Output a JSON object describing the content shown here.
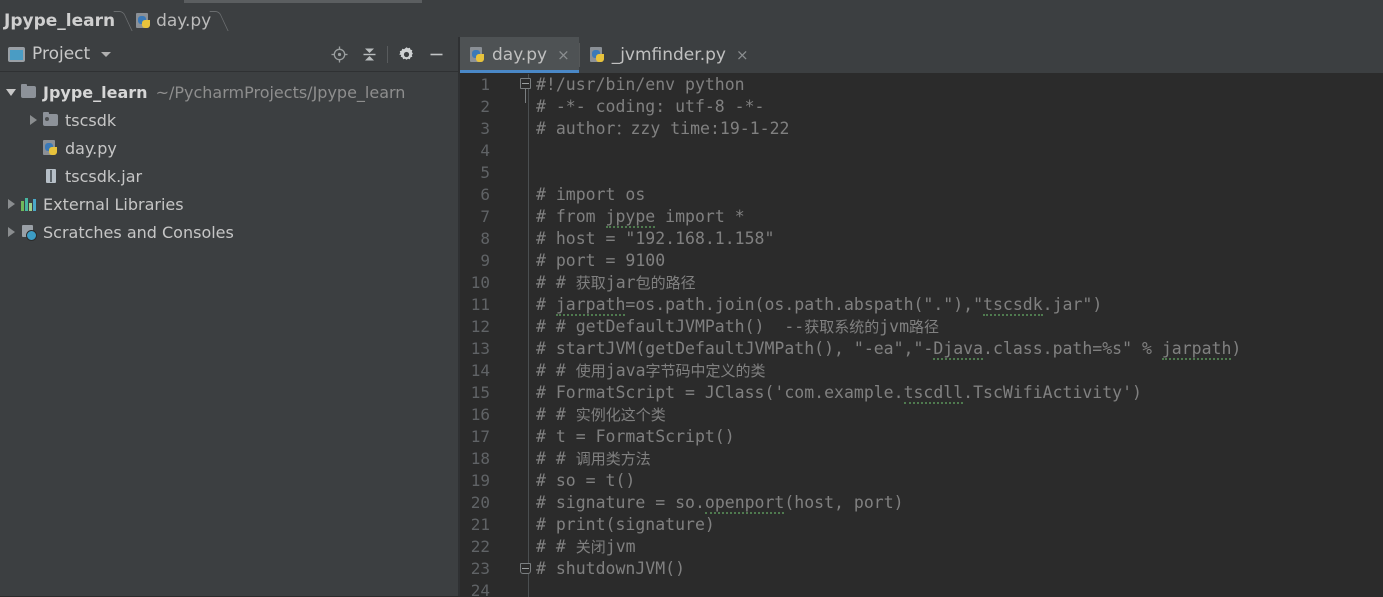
{
  "window": {
    "theme_bg": "#3c3f41",
    "editor_bg": "#2b2b2b",
    "accent": "#4a88c7"
  },
  "breadcrumb": {
    "items": [
      {
        "label": "Jpype_learn",
        "icon": "none"
      },
      {
        "label": "day.py",
        "icon": "python-file-icon"
      }
    ]
  },
  "project_panel": {
    "title": "Project",
    "dropdown_icon": "chevron-down-icon",
    "panel_icon": "project-window-icon",
    "tools": [
      {
        "name": "locate-icon",
        "label": "Select Opened File"
      },
      {
        "name": "collapse-all-icon",
        "label": "Collapse All"
      },
      {
        "name": "gear-icon",
        "label": "Settings"
      },
      {
        "name": "minimize-icon",
        "label": "Hide"
      }
    ],
    "tree": [
      {
        "label": "Jpype_learn",
        "sublabel": "~/PycharmProjects/Jpype_learn",
        "icon": "folder-icon",
        "twisty": "expanded",
        "indent": 0,
        "bold": true
      },
      {
        "label": "tscsdk",
        "sublabel": "",
        "icon": "source-folder-icon",
        "twisty": "collapsed",
        "indent": 1,
        "bold": false
      },
      {
        "label": "day.py",
        "sublabel": "",
        "icon": "python-file-icon",
        "twisty": "none",
        "indent": 1,
        "bold": false
      },
      {
        "label": "tscsdk.jar",
        "sublabel": "",
        "icon": "jar-file-icon",
        "twisty": "none",
        "indent": 1,
        "bold": false
      },
      {
        "label": "External Libraries",
        "sublabel": "",
        "icon": "libraries-icon",
        "twisty": "collapsed",
        "indent": 0,
        "bold": false
      },
      {
        "label": "Scratches and Consoles",
        "sublabel": "",
        "icon": "scratches-icon",
        "twisty": "collapsed",
        "indent": 0,
        "bold": false
      }
    ]
  },
  "editor": {
    "tabs": [
      {
        "label": "day.py",
        "icon": "python-file-icon",
        "active": true,
        "close": "×"
      },
      {
        "label": "_jvmfinder.py",
        "icon": "python-file-icon",
        "active": false,
        "close": "×"
      }
    ],
    "first_line": 1,
    "lines": [
      {
        "no": 1,
        "text": "#!/usr/bin/env python",
        "fold": "start"
      },
      {
        "no": 2,
        "text": "# -*- coding: utf-8 -*-",
        "fold": ""
      },
      {
        "no": 3,
        "text": "# author：zzy time:19-1-22",
        "fold": ""
      },
      {
        "no": 4,
        "text": "",
        "fold": ""
      },
      {
        "no": 5,
        "text": "",
        "fold": ""
      },
      {
        "no": 6,
        "text": "# import os",
        "fold": ""
      },
      {
        "no": 7,
        "text": "# from jpype import *",
        "fold": ""
      },
      {
        "no": 8,
        "text": "# host = \"192.168.1.158\"",
        "fold": ""
      },
      {
        "no": 9,
        "text": "# port = 9100",
        "fold": ""
      },
      {
        "no": 10,
        "text": "# # 获取jar包的路径",
        "fold": ""
      },
      {
        "no": 11,
        "text": "# jarpath=os.path.join(os.path.abspath(\".\"),\"tscsdk.jar\")",
        "fold": ""
      },
      {
        "no": 12,
        "text": "# # getDefaultJVMPath()  --获取系统的jvm路径",
        "fold": ""
      },
      {
        "no": 13,
        "text": "# startJVM(getDefaultJVMPath(), \"-ea\",\"-Djava.class.path=%s\" % jarpath)",
        "fold": ""
      },
      {
        "no": 14,
        "text": "# # 使用java字节码中定义的类",
        "fold": ""
      },
      {
        "no": 15,
        "text": "# FormatScript = JClass('com.example.tscdll.TscWifiActivity')",
        "fold": ""
      },
      {
        "no": 16,
        "text": "# # 实例化这个类",
        "fold": ""
      },
      {
        "no": 17,
        "text": "# t = FormatScript()",
        "fold": ""
      },
      {
        "no": 18,
        "text": "# # 调用类方法",
        "fold": ""
      },
      {
        "no": 19,
        "text": "# so = t()",
        "fold": ""
      },
      {
        "no": 20,
        "text": "# signature = so.openport(host, port)",
        "fold": ""
      },
      {
        "no": 21,
        "text": "# print(signature)",
        "fold": ""
      },
      {
        "no": 22,
        "text": "# # 关闭jvm",
        "fold": ""
      },
      {
        "no": 23,
        "text": "# shutdownJVM()",
        "fold": "end"
      },
      {
        "no": 24,
        "text": "",
        "fold": ""
      }
    ],
    "typos": [
      "jpype",
      "jarpath",
      "tscsdk",
      "Djava",
      "tscdll",
      "openport"
    ]
  }
}
